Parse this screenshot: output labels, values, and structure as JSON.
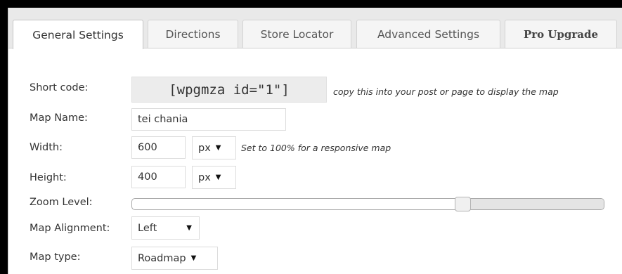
{
  "tabs": [
    {
      "label": "General Settings"
    },
    {
      "label": "Directions"
    },
    {
      "label": "Store Locator"
    },
    {
      "label": "Advanced Settings"
    },
    {
      "label": "Pro Upgrade"
    }
  ],
  "form": {
    "short_code": {
      "label": "Short code:",
      "value": "[wpgmza id=\"1\"]",
      "hint": "copy this into your post or page to display the map"
    },
    "map_name": {
      "label": "Map Name:",
      "value": "tei chania"
    },
    "width": {
      "label": "Width:",
      "value": "600",
      "unit": "px",
      "hint": "Set to 100% for a responsive map"
    },
    "height": {
      "label": "Height:",
      "value": "400",
      "unit": "px"
    },
    "zoom": {
      "label": "Zoom Level:",
      "level_fraction": 0.7
    },
    "alignment": {
      "label": "Map Alignment:",
      "value": "Left"
    },
    "map_type": {
      "label": "Map type:",
      "value": "Roadmap"
    }
  }
}
